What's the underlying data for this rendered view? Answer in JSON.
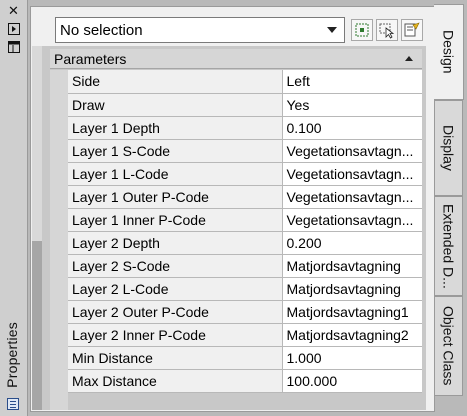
{
  "palette": "Properties",
  "strip_icons": [
    "close-icon",
    "auto-hide-icon",
    "options-menu-icon"
  ],
  "toolbar": {
    "selection": "No selection",
    "buttons": [
      "toggle-pickadd-icon",
      "select-objects-icon",
      "quick-select-icon"
    ]
  },
  "section": {
    "title": "Parameters",
    "expanded": true
  },
  "parameters": [
    {
      "name": "Side",
      "value": "Left"
    },
    {
      "name": "Draw",
      "value": "Yes"
    },
    {
      "name": "Layer 1 Depth",
      "value": "0.100"
    },
    {
      "name": "Layer 1 S-Code",
      "value": "Vegetationsavtagn..."
    },
    {
      "name": "Layer 1 L-Code",
      "value": "Vegetationsavtagn..."
    },
    {
      "name": "Layer 1 Outer P-Code",
      "value": "Vegetationsavtagn..."
    },
    {
      "name": "Layer 1 Inner P-Code",
      "value": "Vegetationsavtagn..."
    },
    {
      "name": "Layer 2 Depth",
      "value": "0.200"
    },
    {
      "name": "Layer 2 S-Code",
      "value": "Matjordsavtagning"
    },
    {
      "name": "Layer 2 L-Code",
      "value": "Matjordsavtagning"
    },
    {
      "name": "Layer 2 Outer P-Code",
      "value": "Matjordsavtagning1"
    },
    {
      "name": "Layer 2 Inner P-Code",
      "value": "Matjordsavtagning2"
    },
    {
      "name": "Min Distance",
      "value": "1.000"
    },
    {
      "name": "Max Distance",
      "value": "100.000"
    }
  ],
  "tabs": [
    {
      "label": "Design",
      "active": true
    },
    {
      "label": "Display",
      "active": false
    },
    {
      "label": "Extended D...",
      "active": false
    },
    {
      "label": "Object Class",
      "active": false
    }
  ],
  "colors": {
    "panel": "#f0f0f0",
    "chrome": "#b9b9b9",
    "accent": "#2a4d8a"
  }
}
